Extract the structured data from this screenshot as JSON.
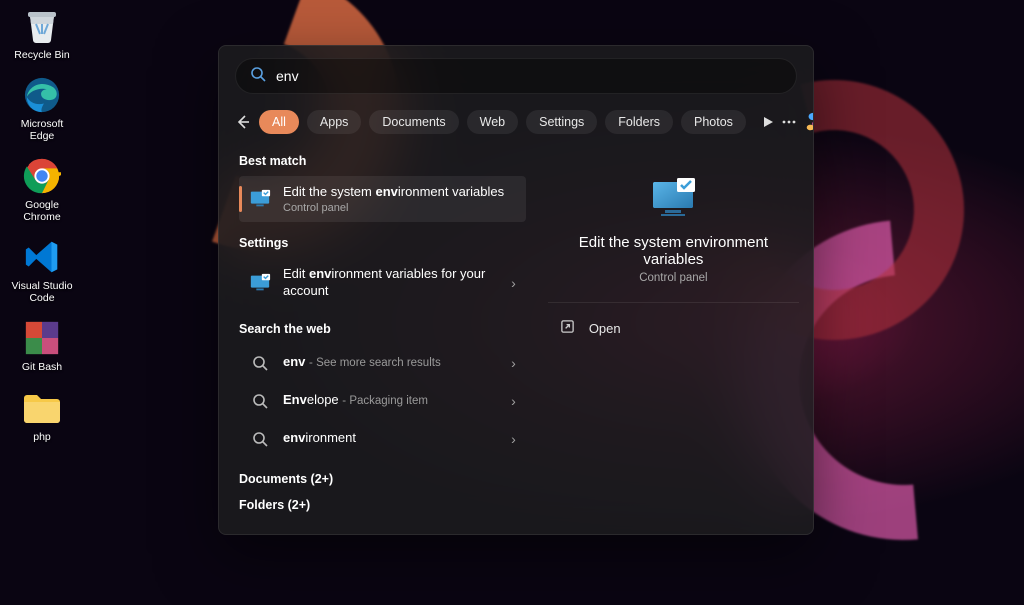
{
  "desktop": {
    "icons": [
      {
        "id": "recycle-bin",
        "label": "Recycle Bin"
      },
      {
        "id": "edge",
        "label": "Microsoft\nEdge"
      },
      {
        "id": "chrome",
        "label": "Google\nChrome"
      },
      {
        "id": "vscode",
        "label": "Visual Studio\nCode"
      },
      {
        "id": "git-bash",
        "label": "Git Bash"
      },
      {
        "id": "php-folder",
        "label": "php"
      }
    ]
  },
  "search": {
    "query": "env",
    "filters": {
      "back_aria": "Back",
      "tabs": [
        "All",
        "Apps",
        "Documents",
        "Web",
        "Settings",
        "Folders",
        "Photos"
      ],
      "active_index": 0
    },
    "sections": {
      "best_match": {
        "header": "Best match",
        "item": {
          "title_pre": "Edit the system ",
          "title_bold": "env",
          "title_post": "ironment variables",
          "subtitle": "Control panel"
        }
      },
      "settings": {
        "header": "Settings",
        "item": {
          "title_pre": "Edit ",
          "title_bold": "env",
          "title_post": "ironment variables for your account"
        }
      },
      "web": {
        "header": "Search the web",
        "items": [
          {
            "pre": "",
            "bold": "env",
            "post": "",
            "suffix": "See more search results"
          },
          {
            "pre": "",
            "bold": "Env",
            "post": "elope",
            "suffix": "Packaging item"
          },
          {
            "pre": "",
            "bold": "env",
            "post": "ironment",
            "suffix": ""
          }
        ]
      },
      "documents": {
        "header": "Documents (2+)"
      },
      "folders": {
        "header": "Folders (2+)"
      }
    },
    "preview": {
      "title": "Edit the system environment variables",
      "subtitle": "Control panel",
      "actions": {
        "open": "Open"
      }
    }
  }
}
